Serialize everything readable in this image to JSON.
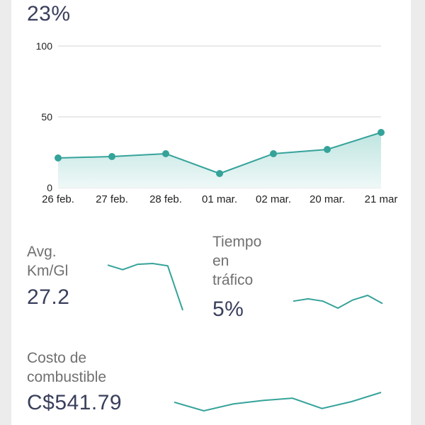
{
  "header": {
    "percent": "23%"
  },
  "chart_data": {
    "type": "area",
    "categories": [
      "26 feb.",
      "27 feb.",
      "28 feb.",
      "01 mar.",
      "02 mar.",
      "20 mar.",
      "21 mar"
    ],
    "values": [
      21,
      22,
      24,
      10,
      24,
      27,
      39
    ],
    "yticks": [
      "100",
      "50",
      "0"
    ],
    "ylim": [
      0,
      100
    ],
    "grid": true,
    "colors": {
      "line": "#35a39a",
      "fill_top": "#bfe5e1",
      "fill_bottom": "#eef8f7",
      "grid": "#d6d6d6"
    }
  },
  "metrics": {
    "avg": {
      "label_line1": "Avg.",
      "label_line2": "Km/Gl",
      "value": "27.2",
      "spark": [
        3.4,
        1.0,
        3.8,
        4.2,
        3.0,
        -20
      ]
    },
    "traffic": {
      "label_line1": "Tiempo",
      "label_line2": "en",
      "label_line3": "tráfico",
      "value": "5%",
      "spark": [
        5,
        5.4,
        5.0,
        3.8,
        5.2,
        6.0,
        4.6
      ]
    },
    "fuel": {
      "label_line1": "Costo de",
      "label_line2": "combustible",
      "value": "C$541.79",
      "spark": [
        3,
        0,
        2.4,
        3.6,
        4.4,
        0.8,
        3.2,
        6.4
      ]
    }
  }
}
